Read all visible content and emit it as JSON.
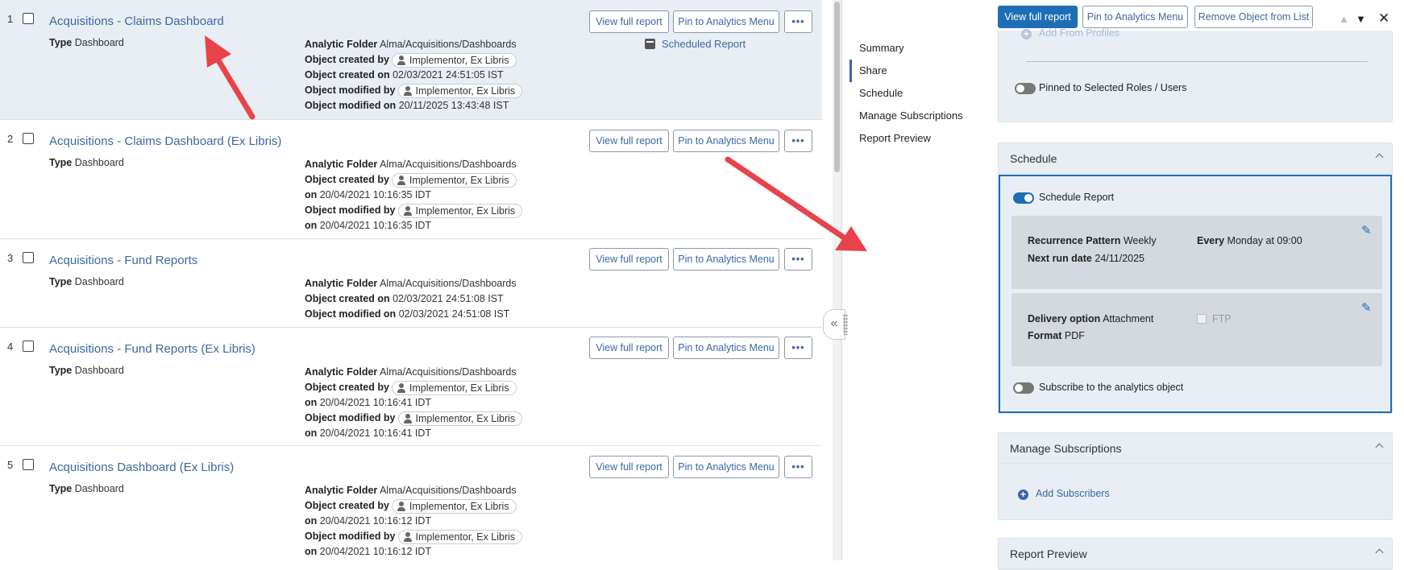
{
  "results": [
    {
      "num": "1",
      "title": "Acquisitions - Claims Dashboard",
      "type_label": "Type",
      "type": "Dashboard",
      "folder_label": "Analytic Folder",
      "folder": "Alma/Acquisitions/Dashboards",
      "created_by_label": "Object created by",
      "created_by": "Implementor, Ex Libris",
      "created_on_label": "Object created on",
      "created_on": "02/03/2021 24:51:05 IST",
      "modified_by_label": "Object modified by",
      "modified_by": "Implementor, Ex Libris",
      "modified_on_label": "Object modified on",
      "modified_on": "20/11/2025 13:43:48 IST",
      "scheduled_link": "Scheduled Report"
    },
    {
      "num": "2",
      "title": "Acquisitions - Claims Dashboard (Ex Libris)",
      "type_label": "Type",
      "type": "Dashboard",
      "folder_label": "Analytic Folder",
      "folder": "Alma/Acquisitions/Dashboards",
      "created_by_label": "Object created by",
      "created_by": "Implementor, Ex Libris",
      "created_on_label": "on",
      "created_on": "20/04/2021 10:16:35 IDT",
      "modified_by_label": "Object modified by",
      "modified_by": "Implementor, Ex Libris",
      "modified_on_label": "on",
      "modified_on": "20/04/2021 10:16:35 IDT"
    },
    {
      "num": "3",
      "title": "Acquisitions - Fund Reports",
      "type_label": "Type",
      "type": "Dashboard",
      "folder_label": "Analytic Folder",
      "folder": "Alma/Acquisitions/Dashboards",
      "created_on_label": "Object created on",
      "created_on": "02/03/2021 24:51:08 IST",
      "modified_on_label": "Object modified on",
      "modified_on": "02/03/2021 24:51:08 IST"
    },
    {
      "num": "4",
      "title": "Acquisitions - Fund Reports (Ex Libris)",
      "type_label": "Type",
      "type": "Dashboard",
      "folder_label": "Analytic Folder",
      "folder": "Alma/Acquisitions/Dashboards",
      "created_by_label": "Object created by",
      "created_by": "Implementor, Ex Libris",
      "created_on_label": "on",
      "created_on": "20/04/2021 10:16:41 IDT",
      "modified_by_label": "Object modified by",
      "modified_by": "Implementor, Ex Libris",
      "modified_on_label": "on",
      "modified_on": "20/04/2021 10:16:41 IDT"
    },
    {
      "num": "5",
      "title": "Acquisitions Dashboard (Ex Libris)",
      "type_label": "Type",
      "type": "Dashboard",
      "folder_label": "Analytic Folder",
      "folder": "Alma/Acquisitions/Dashboards",
      "created_by_label": "Object created by",
      "created_by": "Implementor, Ex Libris",
      "created_on_label": "on",
      "created_on": "20/04/2021 10:16:12 IDT",
      "modified_by_label": "Object modified by",
      "modified_by": "Implementor, Ex Libris",
      "modified_on_label": "on",
      "modified_on": "20/04/2021 10:16:12 IDT"
    }
  ],
  "row_buttons": {
    "view": "View full report",
    "pin": "Pin to Analytics Menu",
    "more": "•••"
  },
  "details": {
    "nav": [
      "Summary",
      "Share",
      "Schedule",
      "Manage Subscriptions",
      "Report Preview"
    ],
    "nav_active": "Share",
    "toolbar": {
      "view": "View full report",
      "pin": "Pin to Analytics Menu",
      "remove": "Remove Object from List"
    },
    "share": {
      "add_profiles": "Add From Profiles",
      "pinned_toggle": "Pinned to Selected Roles / Users",
      "pinned_on": false
    },
    "schedule": {
      "title": "Schedule",
      "toggle_label": "Schedule Report",
      "toggle_on": true,
      "recurrence_label": "Recurrence Pattern",
      "recurrence": "Weekly",
      "every_label": "Every",
      "every": "Monday at 09:00",
      "next_run_label": "Next run date",
      "next_run": "24/11/2025",
      "delivery_label": "Delivery option",
      "delivery": "Attachment",
      "ftp_label": "FTP",
      "format_label": "Format",
      "format": "PDF",
      "subscribe_label": "Subscribe to the analytics object",
      "subscribe_on": false
    },
    "subscriptions": {
      "title": "Manage Subscriptions",
      "add": "Add Subscribers"
    },
    "preview": {
      "title": "Report Preview"
    }
  },
  "colors": {
    "link": "#3b68a3",
    "primary": "#1e6eb5",
    "selected_row": "#e8eef4",
    "arrow": "#e8434a"
  }
}
